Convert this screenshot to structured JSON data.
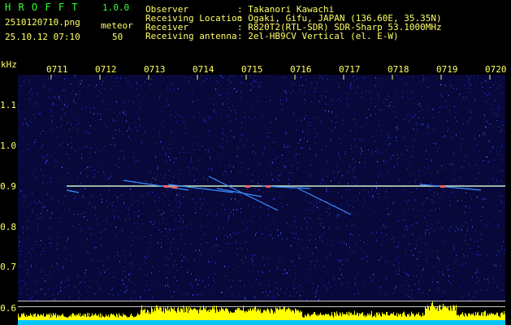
{
  "header": {
    "app_name": "H R O F F T",
    "version": "1.0.0",
    "filename": "2510120710.png",
    "meteor_label": "meteor",
    "datetime": "25.10.12 07:10",
    "meteor_count": "50",
    "fields": [
      {
        "label": "Observer",
        "value": ": Takanori Kawachi"
      },
      {
        "label": "Receiving Location",
        "value": ": Ogaki, Gifu, JAPAN (136.60E, 35.35N)"
      },
      {
        "label": "Receiver",
        "value": ": R820T2(RTL-SDR) SDR-Sharp 53.1000MHz"
      },
      {
        "label": "Receiving antenna",
        "value": ": 2el-HB9CV Vertical (el. E-W)"
      }
    ]
  },
  "spectrogram": {
    "y_unit": "kHz",
    "y_ticks": [
      "1.1",
      "1.0",
      "0.9",
      "0.8",
      "0.7",
      "0.6"
    ],
    "x_ticks": [
      "0711",
      "0712",
      "0713",
      "0714",
      "0715",
      "0716",
      "0717",
      "0718",
      "0719",
      "0720"
    ],
    "colors": {
      "background": "#08083a",
      "noise": "#1c2aa8",
      "carrier": "#c8f0c8",
      "meteor": "#3a8cff",
      "level_fill": "#ffff00",
      "level_base": "#00c8ff"
    }
  }
}
